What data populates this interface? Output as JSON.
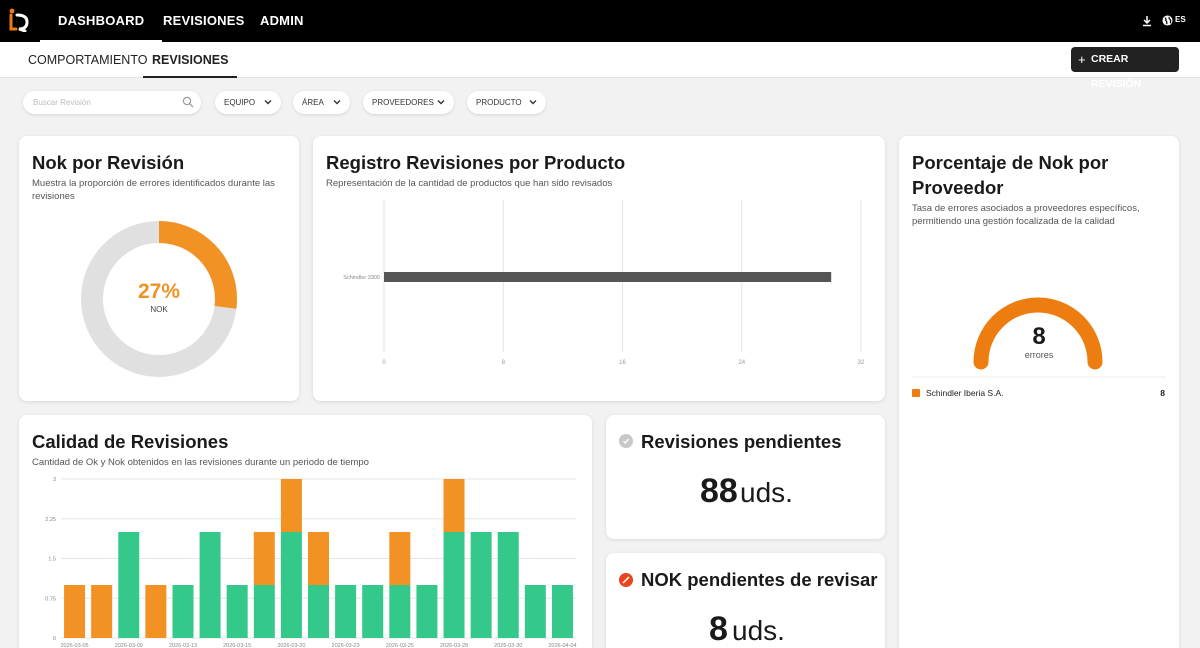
{
  "nav": {
    "items": [
      "DASHBOARD",
      "REVISIONES",
      "ADMIN"
    ],
    "lang": "ES"
  },
  "subnav": {
    "tabs": [
      "COMPORTAMIENTO",
      "REVISIONES"
    ],
    "create_label": "CREAR REVISIÓN"
  },
  "filters": {
    "search_placeholder": "Buscar Revisión",
    "items": [
      "EQUIPO",
      "ÁREA",
      "PROVEEDORES",
      "PRODUCTO"
    ]
  },
  "colors": {
    "ok": "#34c98a",
    "nok": "#f29225",
    "gauge": "#ed7d10",
    "bar": "#555555",
    "donut_bg": "#e0e0e0",
    "pending_icon": "#c8c8c8",
    "nok_icon": "#e8451e"
  },
  "cards": {
    "nok_revision": {
      "title": "Nok por Revisión",
      "subtitle": "Muestra la proporción de errores identificados durante las revisiones",
      "percent_text": "27%",
      "percent_value": 27,
      "label": "NOK"
    },
    "registro": {
      "title": "Registro Revisiones por Producto",
      "subtitle": "Representación de la cantidad de productos que han sido revisados"
    },
    "porcentaje": {
      "title": "Porcentaje de Nok por Proveedor",
      "subtitle": "Tasa de errores asociados a proveedores específicos, permitiendo una gestión focalizada de la calidad",
      "gauge_value": "8",
      "gauge_label": "errores",
      "legend": [
        {
          "name": "Schindler Iberia S.A.",
          "value": "8"
        }
      ]
    },
    "calidad": {
      "title": "Calidad de Revisiones",
      "subtitle": "Cantidad de Ok y Nok obtenidos en las revisiones durante un periodo de tiempo"
    },
    "pendientes": {
      "title": "Revisiones pendientes",
      "value": "88",
      "unit": "uds."
    },
    "nok_pendientes": {
      "title": "NOK pendientes de revisar",
      "value": "8",
      "unit": "uds."
    }
  },
  "chart_data": [
    {
      "type": "bar",
      "orientation": "horizontal",
      "categories": [
        "Schindler 3300"
      ],
      "values": [
        30
      ],
      "xlim": [
        0,
        32
      ],
      "x_ticks": [
        "0",
        "8",
        "16",
        "24",
        "32"
      ],
      "grid": true
    },
    {
      "type": "bar",
      "stacked": true,
      "categories": [
        "2026-03-05",
        "",
        "2026-03-09",
        "",
        "2026-03-13",
        "",
        "2026-03-15",
        "",
        "2026-03-20",
        "",
        "2026-03-23",
        "",
        "2026-03-25",
        "",
        "2026-03-28",
        "",
        "2026-03-30",
        "",
        "2026-04-04"
      ],
      "series": [
        {
          "values": [
            0,
            0,
            2,
            0,
            1,
            2,
            1,
            1,
            2,
            1,
            1,
            1,
            1,
            1,
            2,
            2,
            2,
            1,
            1
          ]
        },
        {
          "values": [
            1,
            1,
            0,
            1,
            0,
            0,
            0,
            1,
            1,
            1,
            0,
            0,
            1,
            0,
            1,
            0,
            0,
            0,
            0
          ]
        }
      ],
      "ylim": [
        0,
        3
      ],
      "y_ticks": [
        "0",
        "0.75",
        "1.5",
        "2.25",
        "3"
      ],
      "grid": true
    }
  ]
}
